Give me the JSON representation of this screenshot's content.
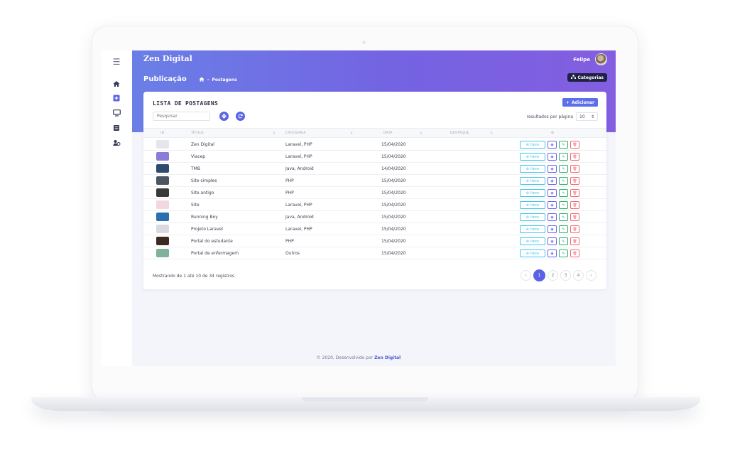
{
  "app": {
    "brand": "Zen Digital",
    "user_name": "Felipe"
  },
  "header": {
    "page_title": "Publicação",
    "breadcrumb": "Postagens",
    "categories_button": "Categorias"
  },
  "sidebar": {
    "items": [
      {
        "icon": "home-icon"
      },
      {
        "icon": "plus-square-icon"
      },
      {
        "icon": "monitor-icon"
      },
      {
        "icon": "list-icon"
      },
      {
        "icon": "users-icon"
      }
    ]
  },
  "card": {
    "title": "LISTA DE POSTAGENS",
    "add_button": "Adicionar",
    "search_placeholder": "Pesquisar",
    "per_page_label": "resultados por página",
    "per_page_value": "10"
  },
  "table": {
    "headers": {
      "id": "ID",
      "title": "TÍTULO",
      "category": "CATEGORIA",
      "date": "DATA",
      "featured": "DESTAQUE",
      "actions": "⚙"
    },
    "action_items_label": "Itens",
    "rows": [
      {
        "title": "Zen Digital",
        "category": "Laravel, PHP",
        "date": "15/04/2020",
        "thumb": "#e4e6ee"
      },
      {
        "title": "Viacep",
        "category": "Laravel, PHP",
        "date": "15/04/2020",
        "thumb": "#8b7cd8"
      },
      {
        "title": "TMB",
        "category": "Java, Android",
        "date": "14/04/2020",
        "thumb": "#2f4a6d"
      },
      {
        "title": "Site simples",
        "category": "PHP",
        "date": "15/04/2020",
        "thumb": "#4b5660"
      },
      {
        "title": "Site antigo",
        "category": "PHP",
        "date": "15/04/2020",
        "thumb": "#3a3a3a"
      },
      {
        "title": "Site",
        "category": "Laravel, PHP",
        "date": "15/04/2020",
        "thumb": "#f3d7de"
      },
      {
        "title": "Running Boy",
        "category": "Java, Android",
        "date": "15/04/2020",
        "thumb": "#2b6fb0"
      },
      {
        "title": "Projeto Laravel",
        "category": "Laravel, PHP",
        "date": "15/04/2020",
        "thumb": "#d9dae0"
      },
      {
        "title": "Portal do estudante",
        "category": "PHP",
        "date": "15/04/2020",
        "thumb": "#3b2a22"
      },
      {
        "title": "Portal de enfermagem",
        "category": "Outros",
        "date": "15/04/2020",
        "thumb": "#7fb29a"
      }
    ]
  },
  "pagination": {
    "info": "Mostrando de 1 até 10 de 34 registros",
    "prev": "‹",
    "pages": [
      "1",
      "2",
      "3",
      "4"
    ],
    "active_page": "1",
    "next": "›"
  },
  "footer": {
    "text": "© 2020, Desenvolvido por",
    "brand": "Zen Digital"
  },
  "colors": {
    "accent": "#5a63e6",
    "hero_start": "#6a7fe6",
    "hero_end": "#835ee0",
    "info": "#43c6e8",
    "success": "#2fb36b",
    "danger": "#f06a73"
  }
}
